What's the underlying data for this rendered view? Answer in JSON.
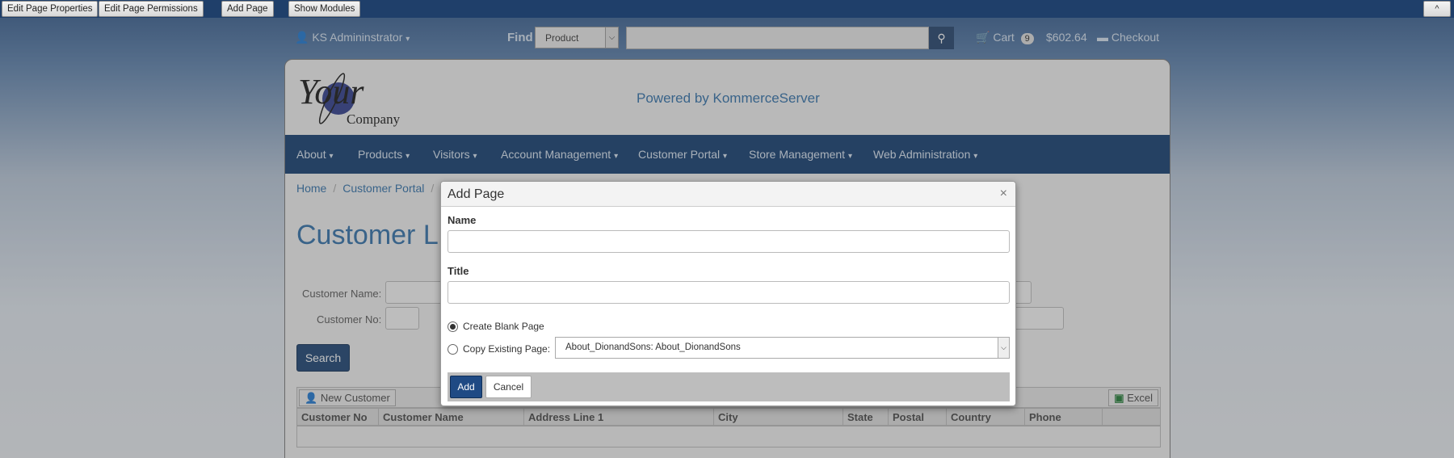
{
  "admin_bar": {
    "edit_properties": "Edit Page Properties",
    "edit_permissions": "Edit Page Permissions",
    "add_page": "Add Page",
    "show_modules": "Show Modules",
    "collapse": "^"
  },
  "header": {
    "user": "KS Admininstrator",
    "find_label": "Find",
    "find_scope": "Product",
    "find_query": "",
    "cart_label": "Cart",
    "cart_count": "9",
    "cart_total": "$602.64",
    "checkout": "Checkout"
  },
  "site": {
    "logo_main": "Your",
    "logo_sub": "Company",
    "powered_by": "Powered by KommerceServer"
  },
  "nav": {
    "items": [
      {
        "label": "About"
      },
      {
        "label": "Products"
      },
      {
        "label": "Visitors"
      },
      {
        "label": "Account Management"
      },
      {
        "label": "Customer Portal"
      },
      {
        "label": "Store Management"
      },
      {
        "label": "Web Administration"
      }
    ]
  },
  "breadcrumb": [
    "Home",
    "Customer Portal"
  ],
  "page": {
    "title": "Customer Li",
    "customer_name_label": "Customer Name:",
    "customer_no_label": "Customer No:",
    "search_button": "Search"
  },
  "grid": {
    "new_customer": "New Customer",
    "excel": "Excel",
    "columns": [
      "Customer No",
      "Customer Name",
      "Address Line 1",
      "City",
      "State",
      "Postal",
      "Country",
      "Phone"
    ]
  },
  "modal": {
    "title": "Add Page",
    "close": "×",
    "name_label": "Name",
    "name_value": "",
    "title_label": "Title",
    "title_value": "",
    "radio_blank": "Create Blank Page",
    "radio_copy": "Copy Existing Page:",
    "selected_option": "blank",
    "copy_source": "About_DionandSons: About_DionandSons",
    "add_button": "Add",
    "cancel_button": "Cancel"
  },
  "colors": {
    "brand_blue": "#0f3a6d",
    "link_blue": "#2d6ea8"
  }
}
